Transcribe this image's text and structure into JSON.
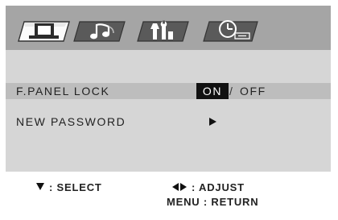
{
  "tabs": [
    {
      "name": "video",
      "icon": "tv-icon",
      "active": true
    },
    {
      "name": "audio",
      "icon": "music-note-icon",
      "active": false
    },
    {
      "name": "setup",
      "icon": "tools-icon",
      "active": false
    },
    {
      "name": "timer",
      "icon": "clock-icon",
      "active": false
    }
  ],
  "menu": {
    "items": [
      {
        "label": "F.PANEL LOCK",
        "options": {
          "on": "ON",
          "separator": "/",
          "off": "OFF"
        },
        "selected": "ON"
      },
      {
        "label": "NEW PASSWORD",
        "icon": "arrow-right-icon"
      }
    ]
  },
  "footer": {
    "select": ": SELECT",
    "adjust": ": ADJUST",
    "return": "MENU : RETURN"
  },
  "colors": {
    "tab_bar": "#a5a5a5",
    "menu_background": "#d6d6d6",
    "highlight_row": "#bdbdbd",
    "selected_option": "#111111"
  }
}
